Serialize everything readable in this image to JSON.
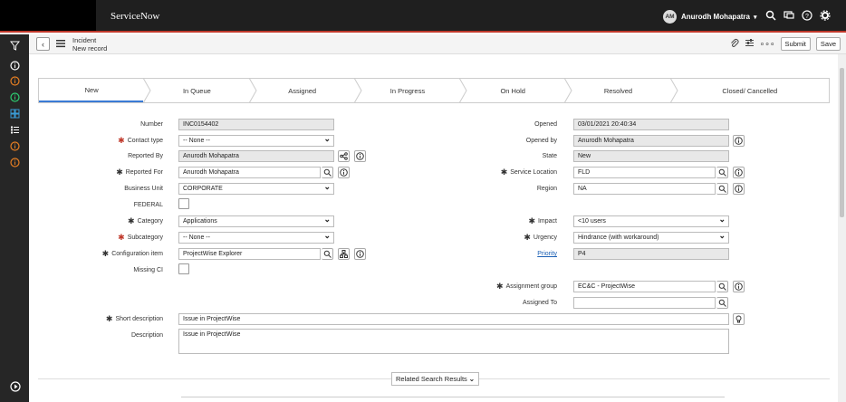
{
  "topbar": {
    "brand": "ServiceNow",
    "user_initials": "AM",
    "user_name": "Anurodh Mohapatra"
  },
  "header": {
    "record_type": "Incident",
    "record_state": "New record",
    "submit_label": "Submit",
    "save_label": "Save"
  },
  "flow": {
    "steps": [
      "New",
      "In Queue",
      "Assigned",
      "In Progress",
      "On Hold",
      "Resolved",
      "Closed/ Cancelled"
    ],
    "active": "New"
  },
  "form": {
    "number": {
      "label": "Number",
      "value": "INC0154402"
    },
    "contact_type": {
      "label": "Contact type",
      "value": "-- None --"
    },
    "reported_by": {
      "label": "Reported By",
      "value": "Anurodh Mohapatra"
    },
    "reported_for": {
      "label": "Reported For",
      "value": "Anurodh Mohapatra"
    },
    "business_unit": {
      "label": "Business Unit",
      "value": "CORPORATE"
    },
    "federal": {
      "label": "FEDERAL"
    },
    "category": {
      "label": "Category",
      "value": "Applications"
    },
    "subcategory": {
      "label": "Subcategory",
      "value": "-- None --"
    },
    "configuration_item": {
      "label": "Configuration item",
      "value": "ProjectWise Explorer"
    },
    "missing_ci": {
      "label": "Missing CI"
    },
    "opened": {
      "label": "Opened",
      "value": "03/01/2021 20:40:34"
    },
    "opened_by": {
      "label": "Opened by",
      "value": "Anurodh Mohapatra"
    },
    "state": {
      "label": "State",
      "value": "New"
    },
    "service_location": {
      "label": "Service Location",
      "value": "FLD"
    },
    "region": {
      "label": "Region",
      "value": "NA"
    },
    "impact": {
      "label": "Impact",
      "value": "<10 users"
    },
    "urgency": {
      "label": "Urgency",
      "value": "Hindrance (with workaround)"
    },
    "priority": {
      "label": "Priority",
      "value": "P4"
    },
    "assignment_group": {
      "label": "Assignment group",
      "value": "EC&C - ProjectWise"
    },
    "assigned_to": {
      "label": "Assigned To",
      "value": ""
    },
    "short_description": {
      "label": "Short description",
      "value": "Issue in ProjectWise"
    },
    "description": {
      "label": "Description",
      "value": "Issue in ProjectWise"
    }
  },
  "related": {
    "label": "Related Search Results"
  },
  "colors": {
    "accent": "#3a7bd5",
    "required": "#c0392b",
    "topbar": "#1f1f1f"
  }
}
